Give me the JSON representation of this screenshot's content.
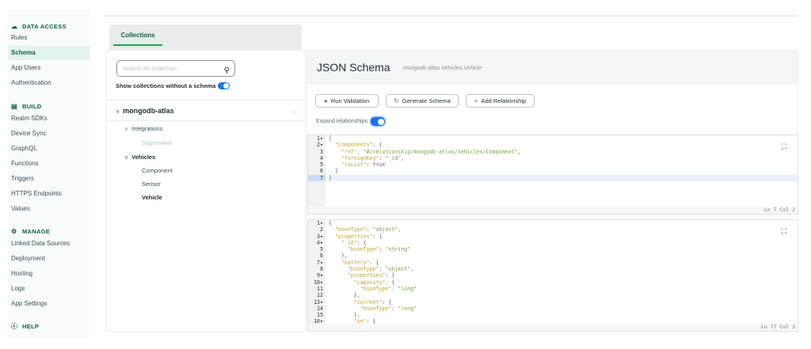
{
  "sidebar": {
    "sections": [
      {
        "label": "DATA ACCESS",
        "icon": "cloud-icon",
        "items": [
          "Rules",
          "Schema",
          "App Users",
          "Authentication"
        ]
      },
      {
        "label": "BUILD",
        "icon": "laptop-icon",
        "items": [
          "Realm SDKs",
          "Device Sync",
          "GraphQL",
          "Functions",
          "Triggers",
          "HTTPS Endpoints",
          "Values"
        ]
      },
      {
        "label": "MANAGE",
        "icon": "gear-icon",
        "items": [
          "Linked Data Sources",
          "Deployment",
          "Hosting",
          "Logs",
          "App Settings"
        ]
      },
      {
        "label": "HELP",
        "icon": "help-icon",
        "items": []
      }
    ],
    "active": "Schema"
  },
  "collections": {
    "tab": "Collections",
    "search_placeholder": "Search for collection",
    "show_without_schema": "Show collections without a schema",
    "datasource": "mongodb-atlas",
    "more": "…",
    "groups": [
      {
        "name": "Integrations",
        "items": [
          "Sagemaker"
        ]
      },
      {
        "name": "Vehicles",
        "items": [
          "Component",
          "Sensor",
          "Vehicle"
        ]
      }
    ],
    "selected": "Vehicle"
  },
  "schema": {
    "title": "JSON Schema",
    "namespace": "mongodb-atlas.Vehicles.Vehicle",
    "buttons": {
      "run": "Run Validation",
      "generate": "Generate Schema",
      "add": "Add Relationship"
    },
    "expand_label": "Expand relationships",
    "editor1": {
      "lines": [
        "{",
        "  \"components\": {",
        "    \"ref\": \"#/relationship/mongodb-atlas/Vehicles/Component\",",
        "    \"foreignKey\": \"_id\",",
        "    \"isList\": true",
        "  }",
        "}"
      ],
      "status": "Ln 7 Col 2"
    },
    "editor2": {
      "lines": [
        "{",
        "  \"bsonType\": \"object\",",
        "  \"properties\": {",
        "    \"_id\": {",
        "      \"bsonType\": \"string\"",
        "    },",
        "    \"battery\": {",
        "      \"bsonType\": \"object\",",
        "      \"properties\": {",
        "        \"capacity\": {",
        "          \"bsonType\": \"long\"",
        "        },",
        "        \"current\": {",
        "          \"bsonType\": \"long\"",
        "        },",
        "        \"sn\": {"
      ],
      "status": "Ln 77 Col 2"
    }
  }
}
